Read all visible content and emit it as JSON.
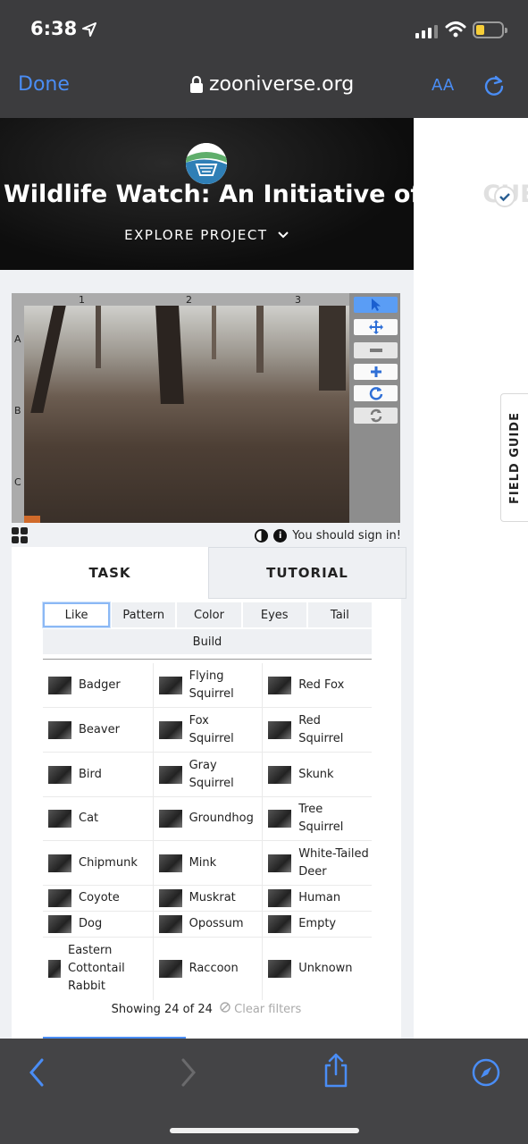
{
  "status_bar": {
    "time": "6:38"
  },
  "browser": {
    "done_label": "Done",
    "url": "zooniverse.org",
    "text_size_label": "AA"
  },
  "hero": {
    "title": "Wildlife Watch: An Initiative of the",
    "title_suffix": "CUES",
    "explore_label": "EXPLORE PROJECT"
  },
  "field_guide_label": "FIELD GUIDE",
  "viewer": {
    "col_labels": [
      "1",
      "2",
      "3"
    ],
    "row_labels": [
      "A",
      "B",
      "C"
    ],
    "signin_text": "You should sign in!"
  },
  "task_panel": {
    "tabs": [
      "TASK",
      "TUTORIAL"
    ],
    "filters": [
      "Like",
      "Pattern",
      "Color",
      "Eyes",
      "Tail"
    ],
    "filter_build": "Build",
    "choices": [
      [
        "Badger",
        "Flying\nSquirrel",
        "Red Fox"
      ],
      [
        "Beaver",
        "Fox\nSquirrel",
        "Red\nSquirrel"
      ],
      [
        "Bird",
        "Gray\nSquirrel",
        "Skunk"
      ],
      [
        "Cat",
        "Groundhog",
        "Tree\nSquirrel"
      ],
      [
        "Chipmunk",
        "Mink",
        "White-Tailed\nDeer"
      ],
      [
        "Coyote",
        "Muskrat",
        "Human"
      ],
      [
        "Dog",
        "Opossum",
        "Empty"
      ],
      [
        "Eastern\nCottontail\nRabbit",
        "Raccoon",
        "Unknown"
      ]
    ],
    "showing_text": "Showing 24 of 24",
    "clear_filters": "Clear filters"
  },
  "colors": {
    "accent": "#4a8df5",
    "chrome": "#3c3c3e"
  }
}
